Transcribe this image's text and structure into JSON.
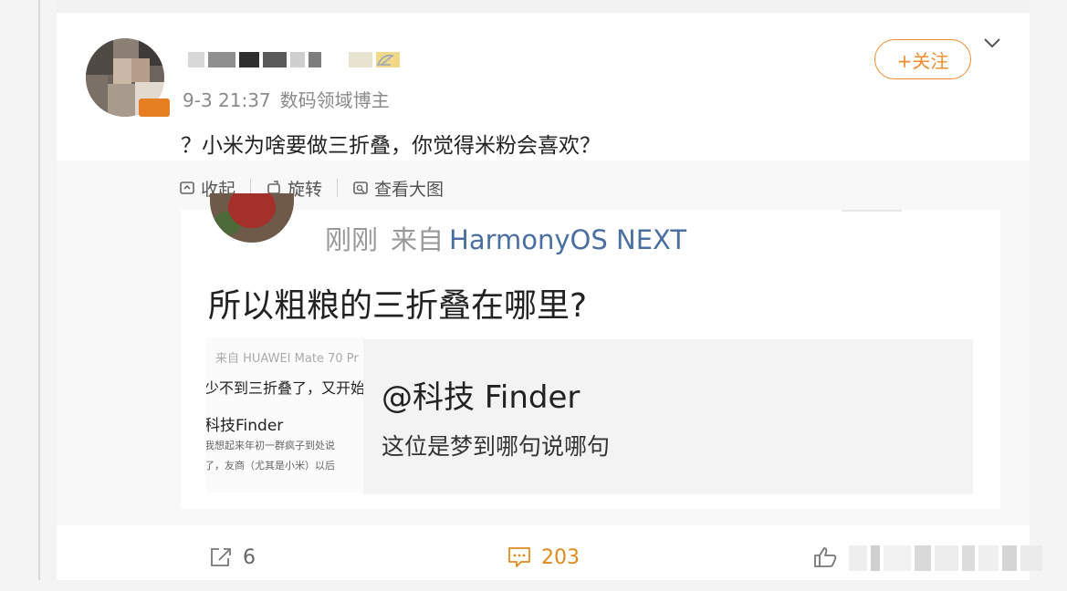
{
  "post": {
    "timestamp": "9-3 21:37",
    "user_tag": "数码领域博主",
    "follow_label": "+关注",
    "text": "？小米为啥要做三折叠，你觉得米粉会喜欢？"
  },
  "media_toolbar": {
    "collapse": "收起",
    "rotate": "旋转",
    "view_large": "查看大图"
  },
  "screenshot": {
    "time": "刚刚",
    "source_prefix": "来自",
    "source_device": "HarmonyOS NEXT",
    "title": "所以粗粮的三折叠在哪里?",
    "quoted_source": "来自 HUAWEI Mate 70 Pr",
    "quoted_line": "少不到三折叠了，又开始",
    "quoted_author": "科技Finder",
    "quoted_snippet_1": "我想起来年初一群疯子到处说",
    "quoted_snippet_2": "了，友商（尤其是小米）以后",
    "reply_mention": "@科技 Finder",
    "reply_text": "这位是梦到哪句说哪句"
  },
  "actions": {
    "repost_count": "6",
    "comment_count": "203"
  },
  "colors": {
    "accent_orange": "#f08c2c",
    "link_blue": "#4a6fa0"
  },
  "icons": [
    "chevron-down-icon",
    "collapse-icon",
    "rotate-icon",
    "view-large-icon",
    "repost-icon",
    "comment-icon",
    "like-icon"
  ]
}
